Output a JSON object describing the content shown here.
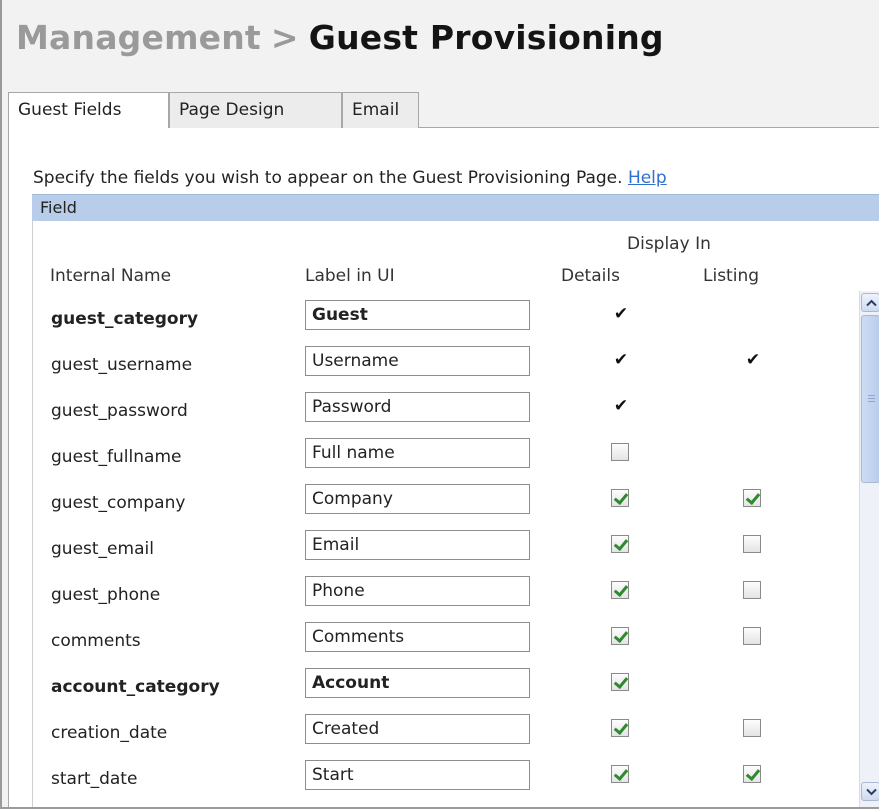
{
  "breadcrumb": {
    "parent": "Management",
    "separator": ">",
    "current": "Guest Provisioning"
  },
  "tabs": [
    {
      "label": "Guest Fields",
      "active": true
    },
    {
      "label": "Page Design",
      "active": false
    },
    {
      "label": "Email",
      "active": false
    }
  ],
  "intro": {
    "text": "Specify the fields you wish to appear on the Guest Provisioning Page.",
    "help_link": "Help"
  },
  "table": {
    "section_header": "Field",
    "group_header": "Display In",
    "columns": {
      "internal_name": "Internal Name",
      "label_in_ui": "Label in UI",
      "details": "Details",
      "listing": "Listing"
    },
    "rows": [
      {
        "name": "guest_category",
        "label": "Guest",
        "bold": true,
        "details": "fixed",
        "listing": "none"
      },
      {
        "name": "guest_username",
        "label": "Username",
        "bold": false,
        "details": "fixed",
        "listing": "fixed"
      },
      {
        "name": "guest_password",
        "label": "Password",
        "bold": false,
        "details": "fixed",
        "listing": "none"
      },
      {
        "name": "guest_fullname",
        "label": "Full name",
        "bold": false,
        "details": "unchecked",
        "listing": "none"
      },
      {
        "name": "guest_company",
        "label": "Company",
        "bold": false,
        "details": "checked",
        "listing": "checked"
      },
      {
        "name": "guest_email",
        "label": "Email",
        "bold": false,
        "details": "checked",
        "listing": "unchecked"
      },
      {
        "name": "guest_phone",
        "label": "Phone",
        "bold": false,
        "details": "checked",
        "listing": "unchecked"
      },
      {
        "name": "comments",
        "label": "Comments",
        "bold": false,
        "details": "checked",
        "listing": "unchecked"
      },
      {
        "name": "account_category",
        "label": "Account",
        "bold": true,
        "details": "checked",
        "listing": "none"
      },
      {
        "name": "creation_date",
        "label": "Created",
        "bold": false,
        "details": "checked",
        "listing": "unchecked"
      },
      {
        "name": "start_date",
        "label": "Start",
        "bold": false,
        "details": "checked",
        "listing": "checked"
      }
    ]
  },
  "fixed_check_glyph": "✔",
  "colors": {
    "breadcrumb_parent": "#9a9a9a",
    "header_bar": "#b7cde9",
    "link": "#2f6fd0",
    "checkmark": "#2d8a2d"
  }
}
